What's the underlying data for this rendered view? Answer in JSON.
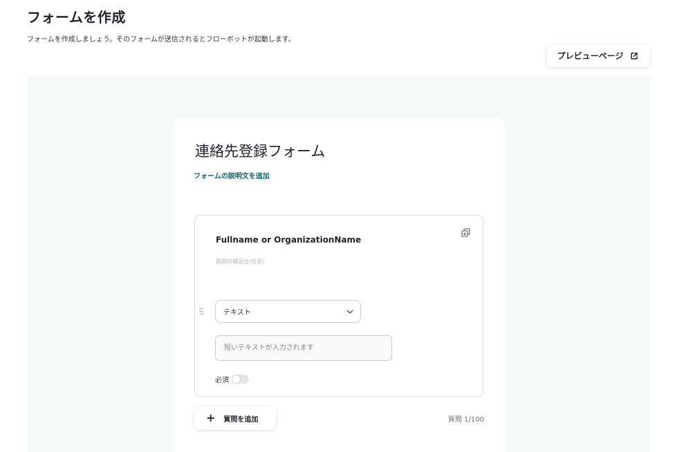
{
  "header": {
    "title": "フォームを作成",
    "subtitle": "フォームを作成しましょう。そのフォームが送信されるとフローボットが起動します。",
    "preview_label": "プレビューページ"
  },
  "form": {
    "title": "連絡先登録フォーム",
    "add_description_label": "フォームの説明文を追加"
  },
  "question": {
    "title": "Fullname or OrganizationName",
    "help_placeholder": "質問の補足分(任意)",
    "type_selected": "テキスト",
    "answer_placeholder": "短いテキストが入力されます",
    "required_label": "必須",
    "required": false
  },
  "footer": {
    "add_question_label": "質問を追加",
    "question_count": "質問 1/100"
  },
  "colors": {
    "canvas_bg": "#f3faf8",
    "link": "#15606f"
  }
}
